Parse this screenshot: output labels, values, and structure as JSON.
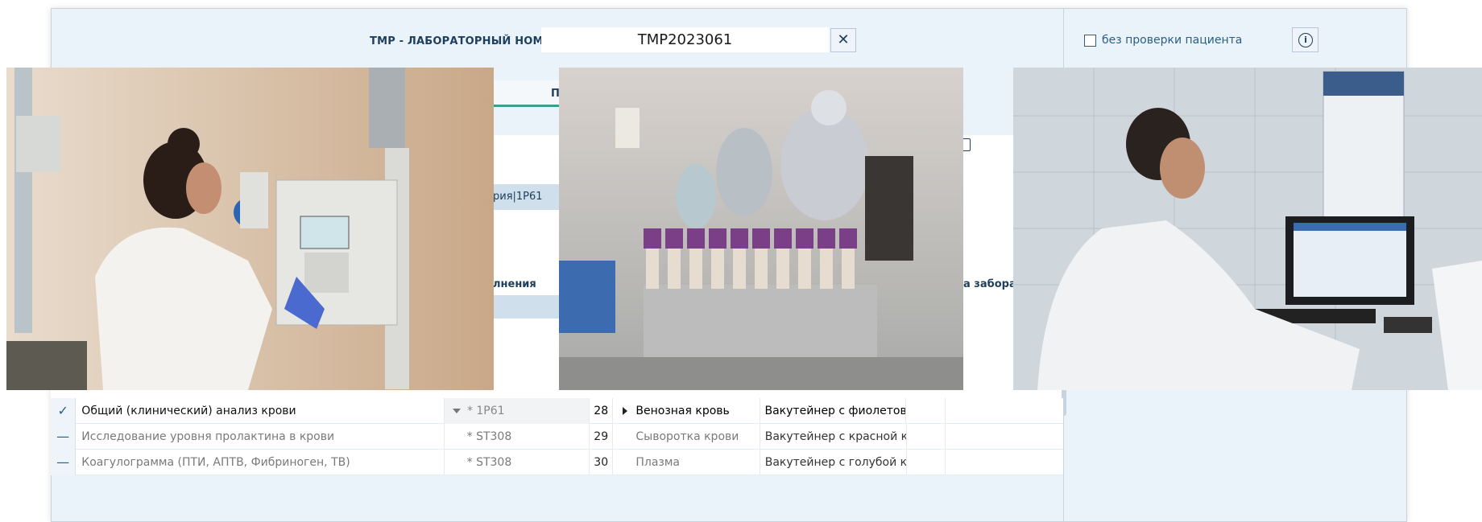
{
  "header": {
    "label": "ТМР - ЛАБОРАТОРНЫЙ НОМЕР:",
    "lab_number": "TMP2023061",
    "close_glyph": "✕",
    "no_check_label": "без проверки пациента",
    "info_glyph": "i"
  },
  "tab": {
    "partial_label": "П"
  },
  "partial": {
    "lab_code_fragment": "рия|1Р61",
    "col_execution": "лнения",
    "col_collection_date": "а забора"
  },
  "rows": [
    {
      "status": "✓",
      "name": "Общий (клинический) анализ крови",
      "code": "* 1Р61",
      "num": "28",
      "specimen": "Венозная кровь",
      "container": "Вакутейнер с фиолетово..."
    },
    {
      "status": "—",
      "name": "Исследование уровня пролактина в крови",
      "code": "* ST308",
      "num": "29",
      "specimen": "Сыворотка крови",
      "container": "Вакутейнер с красной кр..."
    },
    {
      "status": "—",
      "name": "Коагулограмма (ПТИ, АПТВ, Фибриноген, ТВ)",
      "code": "* ST308",
      "num": "30",
      "specimen": "Плазма",
      "container": "Вакутейнер с голубой кр..."
    }
  ],
  "colors": {
    "accent": "#3a9e8c",
    "header_text": "#1d3e5c",
    "window_bg": "#eaf3fa"
  },
  "icons": [
    "close-icon",
    "checkbox-icon",
    "info-icon",
    "document-icon",
    "checkmark-icon",
    "dash-icon",
    "dropdown-icon",
    "expand-icon"
  ]
}
